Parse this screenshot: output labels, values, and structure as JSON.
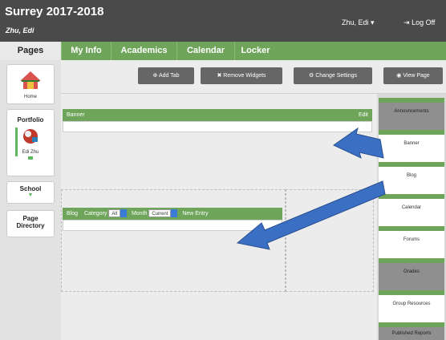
{
  "header": {
    "title": "Surrey 2017-2018",
    "subtitle": "Zhu, Edi",
    "user_menu": "Zhu, Edi ▾",
    "logoff": "Log Off"
  },
  "nav": {
    "pages": "Pages",
    "tabs": [
      "My Info",
      "Academics",
      "Calendar",
      "Locker"
    ]
  },
  "sidebar": {
    "home": "Home",
    "portfolio": "Portfolio",
    "portfolio_user": "Edi Zhu",
    "school": "School",
    "page_directory_1": "Page",
    "page_directory_2": "Directory"
  },
  "toolbar": {
    "add_tab": "Add Tab",
    "remove_widgets": "Remove Widgets",
    "change_settings": "Change Settings",
    "view_page": "View Page"
  },
  "banner_widget": {
    "title": "Banner",
    "edit": "Edit"
  },
  "blog_widget": {
    "title": "Blog",
    "category_label": "Category",
    "category_value": "All",
    "month_label": "Month",
    "month_value": "Current",
    "new_entry": "New Entry"
  },
  "widgets_panel": {
    "items": [
      "Announcements",
      "Banner",
      "Blog",
      "Calendar",
      "Forums",
      "Grades",
      "Group Resources",
      "Published Reports"
    ]
  },
  "colors": {
    "header_bg": "#4a4a4a",
    "nav_green": "#6ea55a",
    "arrow_blue": "#3a6fc4"
  }
}
